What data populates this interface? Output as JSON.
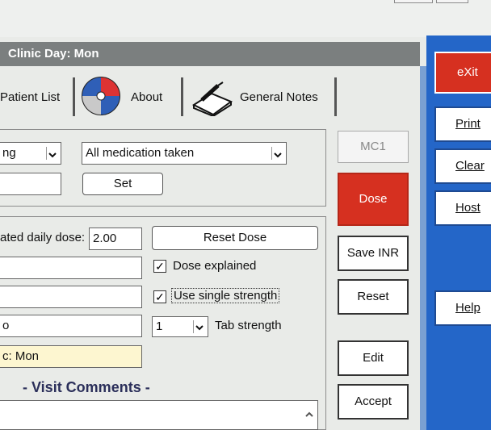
{
  "window": {
    "title": "Clinic Day: Mon"
  },
  "tabs": {
    "patient_list": "Patient List",
    "about": "About",
    "general_notes": "General Notes"
  },
  "medication": {
    "dropdown1_value": "ng",
    "dropdown2_value": "All medication taken",
    "set_label": "Set"
  },
  "dose": {
    "daily_dose_label": "ated daily dose:",
    "daily_dose_value": "2.00",
    "reset_dose_label": "Reset Dose",
    "dose_explained_label": "Dose explained",
    "use_single_strength_label": "Use single strength",
    "tab_strength_value": "1",
    "tab_strength_label": "Tab strength",
    "clinic_text": "c: Mon",
    "row4_text": "o",
    "visit_comments_label": "- Visit Comments -"
  },
  "actions": {
    "mc1": "MC1",
    "dose": "Dose",
    "save_inr": "Save INR",
    "reset": "Reset",
    "edit": "Edit",
    "accept": "Accept"
  },
  "sidebar": {
    "exit": "eXit",
    "print": "Print",
    "clear": "Clear",
    "host": "Host",
    "help": "Help"
  },
  "colors": {
    "accent_red": "#d63020",
    "sidebar_blue": "#2466c8",
    "titlebar": "#7b7f7f",
    "clinic_field": "#fdf6d0"
  }
}
